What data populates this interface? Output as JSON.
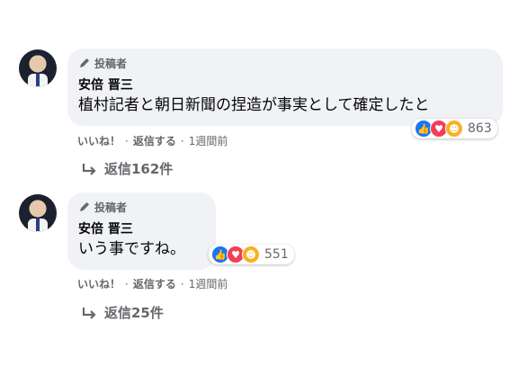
{
  "comments": [
    {
      "badge": "投稿者",
      "author": "安倍 晋三",
      "text": "植村記者と朝日新聞の捏造が事実として確定したと",
      "reaction_count": "863",
      "actions": {
        "like": "いいね！",
        "reply": "返信する",
        "time": "1週間前"
      },
      "replies_label": "返信162件"
    },
    {
      "badge": "投稿者",
      "author": "安倍 晋三",
      "text": "いう事ですね。",
      "reaction_count": "551",
      "actions": {
        "like": "いいね！",
        "reply": "返信する",
        "time": "1週間前"
      },
      "replies_label": "返信25件"
    }
  ],
  "colors": {
    "bubble": "#f0f2f5",
    "like": "#1877f2",
    "love": "#f33e58",
    "care": "#f7b125",
    "muted": "#65676b"
  },
  "icons": {
    "badge": "pencil-icon",
    "reactions": [
      "like-icon",
      "love-icon",
      "care-icon"
    ],
    "replies": "reply-arrow-icon"
  }
}
